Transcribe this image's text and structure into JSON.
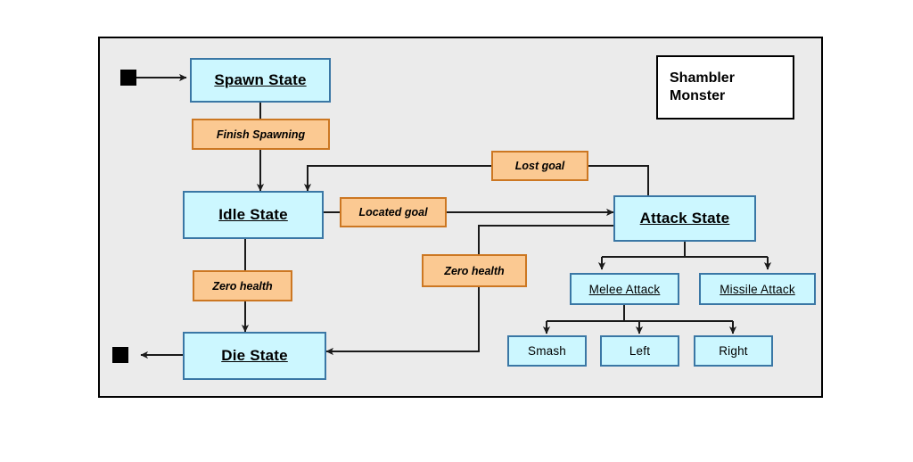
{
  "diagram": {
    "title_box": {
      "line1": "Shambler",
      "line2": "Monster"
    },
    "states": [
      {
        "id": "spawn",
        "label": "Spawn State"
      },
      {
        "id": "idle",
        "label": "Idle State"
      },
      {
        "id": "attack",
        "label": "Attack State"
      },
      {
        "id": "die",
        "label": "Die State"
      },
      {
        "id": "melee",
        "label": "Melee Attack"
      },
      {
        "id": "missile",
        "label": "Missile Attack"
      },
      {
        "id": "smash",
        "label": "Smash"
      },
      {
        "id": "left",
        "label": "Left"
      },
      {
        "id": "right",
        "label": "Right"
      }
    ],
    "transitions": [
      {
        "id": "finish_spawning",
        "label": "Finish Spawning",
        "from": "spawn",
        "to": "idle"
      },
      {
        "id": "located_goal",
        "label": "Located goal",
        "from": "idle",
        "to": "attack"
      },
      {
        "id": "lost_goal",
        "label": "Lost goal",
        "from": "attack",
        "to": "idle"
      },
      {
        "id": "zero_health_idle",
        "label": "Zero health",
        "from": "idle",
        "to": "die"
      },
      {
        "id": "zero_health_attack",
        "label": "Zero health",
        "from": "attack",
        "to": "die"
      }
    ],
    "markers": [
      {
        "id": "initial",
        "kind": "initial-state-marker",
        "to": "spawn"
      },
      {
        "id": "final",
        "kind": "final-state-marker",
        "from": "die"
      }
    ],
    "colors": {
      "page_background": "#ffffff",
      "frame_background": "#ebebeb",
      "frame_border": "#000000",
      "state_fill": "#ccf7ff",
      "state_border": "#3a77a5",
      "transition_fill": "#fbc992",
      "transition_border": "#cc7722",
      "edge": "#1a1a1a",
      "marker": "#000000"
    }
  }
}
